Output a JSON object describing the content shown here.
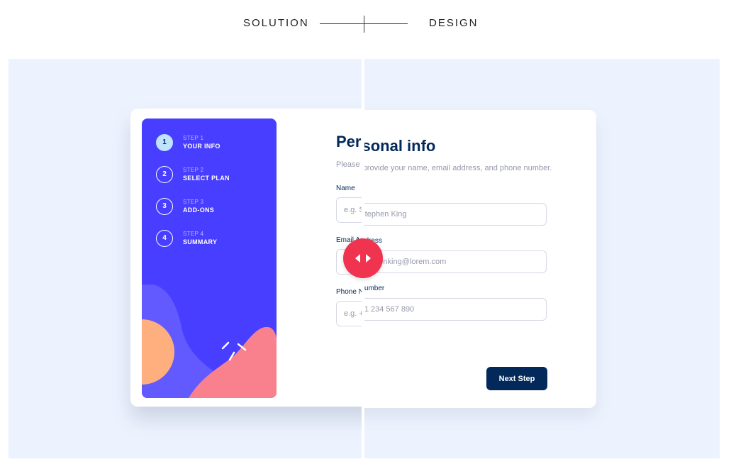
{
  "toggle": {
    "left_label": "SOLUTION",
    "right_label": "DESIGN"
  },
  "sidebar": {
    "steps": [
      {
        "number": "1",
        "step_label": "STEP 1",
        "title": "YOUR INFO",
        "active": true
      },
      {
        "number": "2",
        "step_label": "STEP 2",
        "title": "SELECT PLAN",
        "active": false
      },
      {
        "number": "3",
        "step_label": "STEP 3",
        "title": "ADD-ONS",
        "active": false
      },
      {
        "number": "4",
        "step_label": "STEP 4",
        "title": "SUMMARY",
        "active": false
      }
    ]
  },
  "form": {
    "title": "Personal info",
    "subtitle": "Please provide your name, email address, and phone number.",
    "fields": [
      {
        "label": "Name",
        "placeholder": "e.g. Stephen King",
        "value": ""
      },
      {
        "label": "Email Address",
        "placeholder": "e.g. stephenking@lorem.com",
        "value": ""
      },
      {
        "label": "Phone Number",
        "placeholder": "e.g. +1 234 567 890",
        "value": ""
      }
    ],
    "next_label": "Next Step"
  },
  "comparison": {
    "handle_icon": "left-right-arrows-icon",
    "split_fraction": 0.497
  },
  "colors": {
    "sidebar": "#483eff",
    "active_step": "#bfe2fd",
    "primary_text": "#02295a",
    "handle": "#f0344f",
    "stage_background": "#edf3fe"
  }
}
